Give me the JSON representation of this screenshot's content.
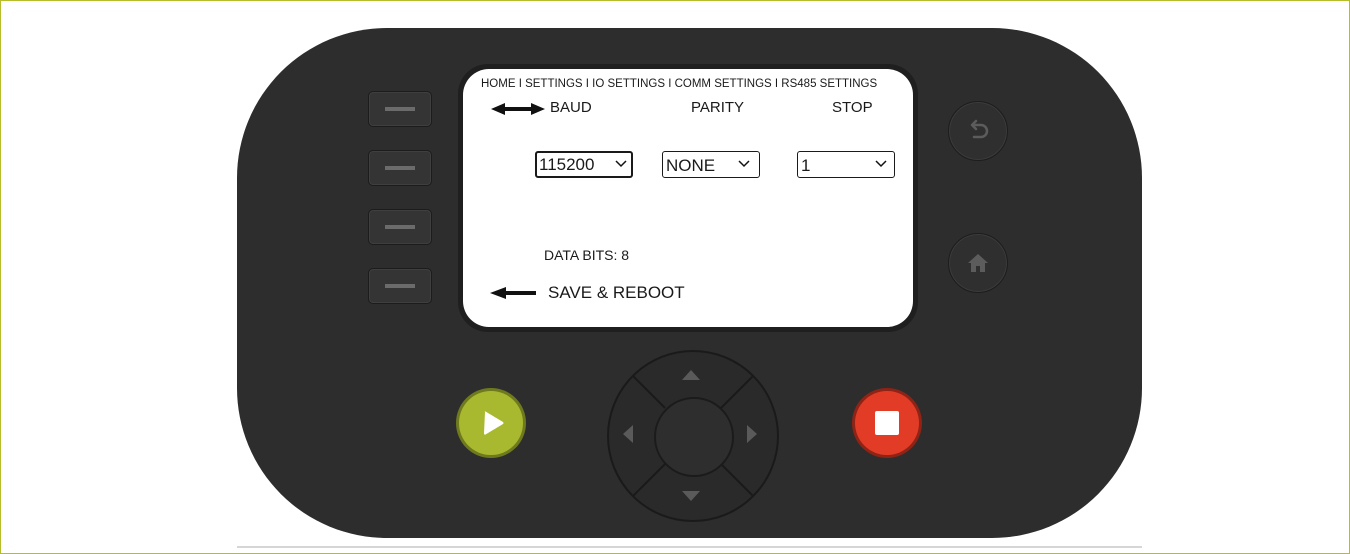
{
  "screen": {
    "breadcrumb": "HOME I SETTINGS I IO SETTINGS I COMM SETTINGS I RS485 SETTINGS",
    "baud": {
      "label": "BAUD",
      "value": "115200",
      "focused": true
    },
    "parity": {
      "label": "PARITY",
      "value": "NONE"
    },
    "stop": {
      "label": "STOP",
      "value": "1"
    },
    "data_bits": "DATA BITS: 8",
    "save_reboot": "SAVE & REBOOT"
  },
  "controls": {
    "soft_keys": [
      "soft-key-1",
      "soft-key-2",
      "soft-key-3",
      "soft-key-4"
    ],
    "right_buttons": [
      "back-icon",
      "home-icon"
    ],
    "dpad": [
      "arrow-up-icon",
      "arrow-down-icon",
      "arrow-left-icon",
      "arrow-right-icon"
    ],
    "play": "play-icon",
    "stop": "stop-icon"
  },
  "colors": {
    "device": "#2d2d2d",
    "play": "#a9b92f",
    "stop": "#e23c26",
    "frame_border": "#b5bd2a"
  }
}
